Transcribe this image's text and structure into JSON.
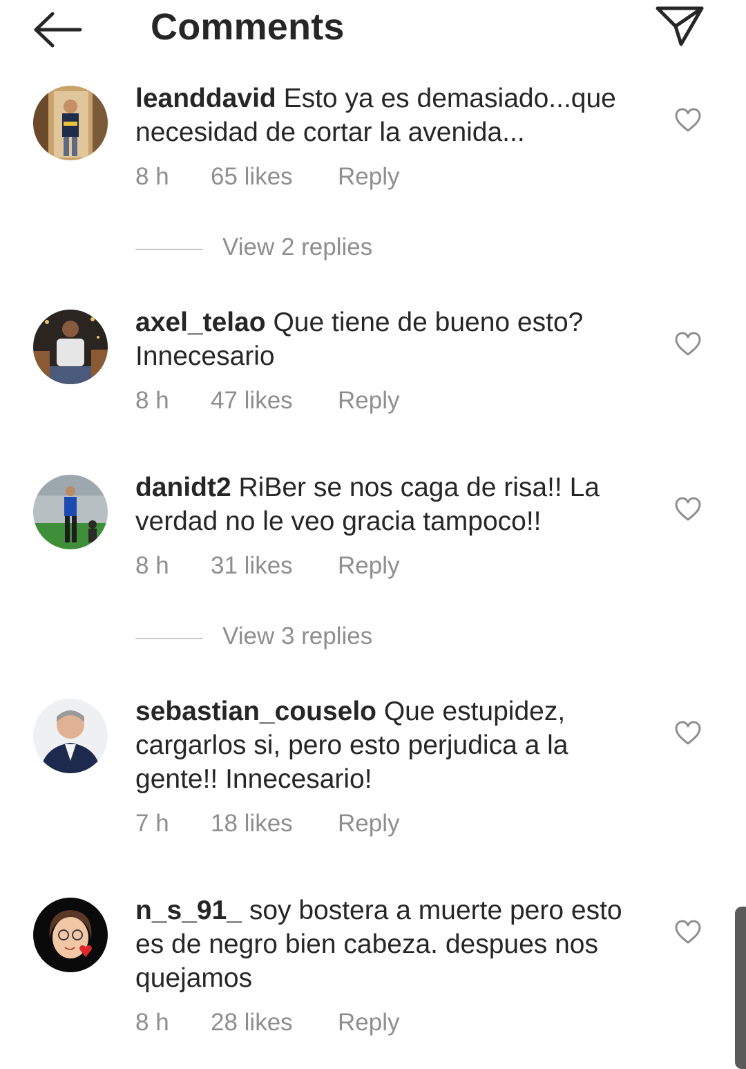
{
  "header": {
    "title": "Comments",
    "back_icon": "arrow-left-icon",
    "share_icon": "paper-plane-icon"
  },
  "comments": [
    {
      "username": "leanddavid",
      "text": "Esto ya es demasiado...que necesidad de cortar la avenida...",
      "time": "8 h",
      "likes": "65 likes",
      "reply": "Reply",
      "view_replies": "View 2 replies"
    },
    {
      "username": "axel_telao",
      "text": "Que tiene de bueno esto? Innecesario",
      "time": "8 h",
      "likes": "47 likes",
      "reply": "Reply"
    },
    {
      "username": "danidt2",
      "text": "RiBer se nos caga de risa!! La verdad no le veo gracia tampoco!!",
      "time": "8 h",
      "likes": "31 likes",
      "reply": "Reply",
      "view_replies": "View 3 replies"
    },
    {
      "username": "sebastian_couselo",
      "text": "Que estupidez, cargarlos si, pero esto perjudica a la gente!! Innecesario!",
      "time": "7 h",
      "likes": "18 likes",
      "reply": "Reply"
    },
    {
      "username": "n_s_91_",
      "text": "soy bostera a muerte pero esto es de negro bien cabeza. despues nos quejamos",
      "time": "8 h",
      "likes": "28 likes",
      "reply": "Reply"
    }
  ],
  "colors": {
    "text": "#262626",
    "secondary": "#8e8e8e",
    "divider": "#c7c7c7"
  }
}
